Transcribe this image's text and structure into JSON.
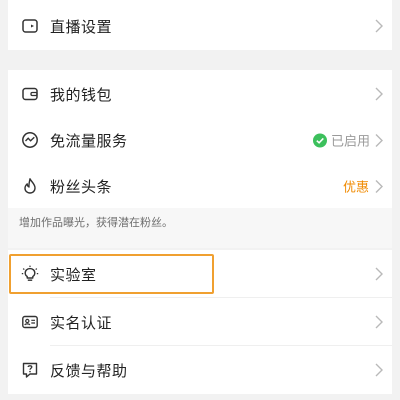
{
  "settings": {
    "live_settings": "直播设置",
    "wallet": "我的钱包",
    "free_data": "免流量服务",
    "free_data_status": "已启用",
    "fan_headlines": "粉丝头条",
    "fan_headlines_promo": "优惠",
    "fan_headlines_hint": "增加作品曝光，获得潜在粉丝。",
    "lab": "实验室",
    "verification": "实名认证",
    "feedback": "反馈与帮助"
  },
  "icons": {
    "live_settings": "video-camera-icon",
    "wallet": "wallet-icon",
    "free_data": "trend-circle-icon",
    "fan_headlines": "flame-icon",
    "lab": "lightbulb-icon",
    "verification": "id-card-icon",
    "feedback": "help-chat-icon",
    "status": "check-circle-icon",
    "chevron": "chevron-right-icon"
  },
  "colors": {
    "status_check": "#3cc05c",
    "promo": "#f08a00",
    "highlight": "#f0a030"
  }
}
